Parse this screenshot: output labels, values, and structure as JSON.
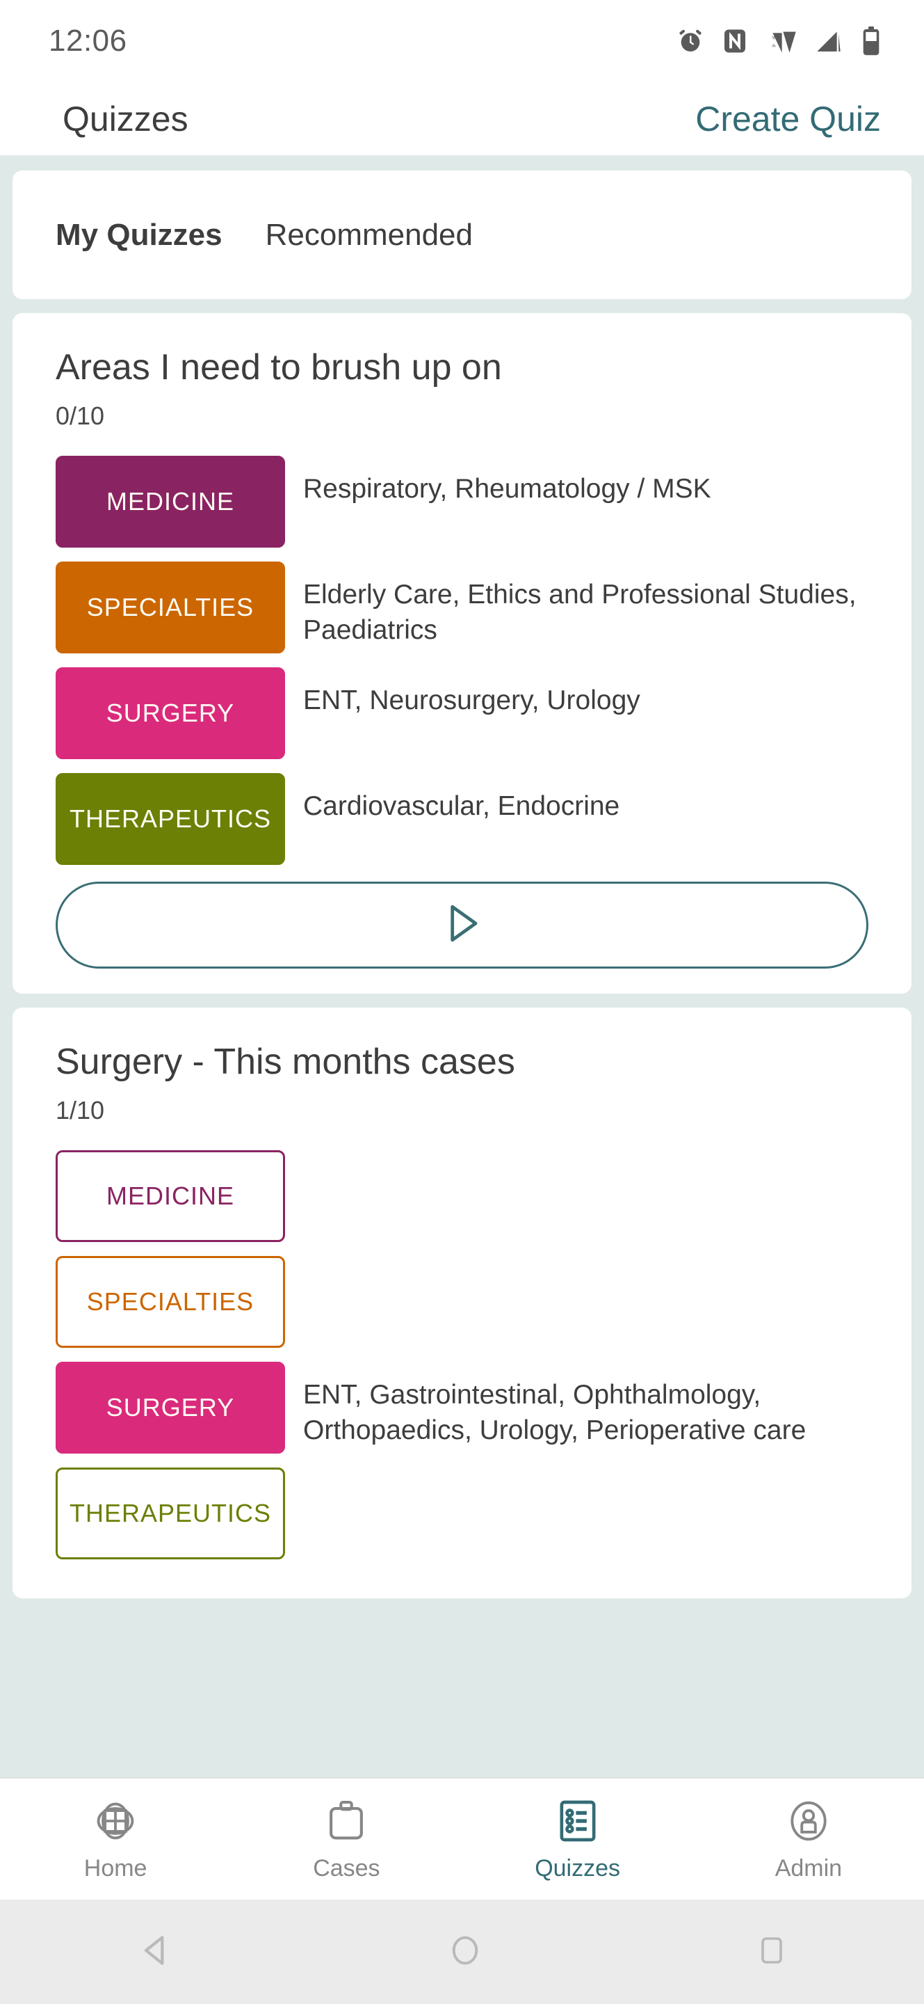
{
  "status_bar": {
    "time": "12:06",
    "icons": [
      "alarm-icon",
      "nfc-icon",
      "wifi-icon",
      "cellular-signal-icon",
      "battery-icon"
    ]
  },
  "header": {
    "title": "Quizzes",
    "action_label": "Create Quiz",
    "accent_color": "#336b75"
  },
  "tabs": [
    {
      "label": "My Quizzes",
      "active": true
    },
    {
      "label": "Recommended",
      "active": false
    }
  ],
  "category_colors": {
    "MEDICINE": "#8a2362",
    "SPECIALTIES": "#cc6600",
    "SURGERY": "#da2a7c",
    "THERAPEUTICS": "#6b8005"
  },
  "quizzes": [
    {
      "title": "Areas I need to brush up on",
      "score": "0/10",
      "categories": [
        {
          "label": "MEDICINE",
          "selected": true,
          "description": "Respiratory, Rheumatology / MSK"
        },
        {
          "label": "SPECIALTIES",
          "selected": true,
          "description": "Elderly Care, Ethics and Professional Studies, Paediatrics"
        },
        {
          "label": "SURGERY",
          "selected": true,
          "description": "ENT, Neurosurgery, Urology"
        },
        {
          "label": "THERAPEUTICS",
          "selected": true,
          "description": "Cardiovascular, Endocrine"
        }
      ],
      "play_button": {
        "icon": "play-icon",
        "label": ""
      }
    },
    {
      "title": "Surgery - This months cases",
      "score": "1/10",
      "categories": [
        {
          "label": "MEDICINE",
          "selected": false,
          "description": ""
        },
        {
          "label": "SPECIALTIES",
          "selected": false,
          "description": ""
        },
        {
          "label": "SURGERY",
          "selected": true,
          "description": "ENT, Gastrointestinal, Ophthalmology, Orthopaedics, Urology, Perioperative care"
        },
        {
          "label": "THERAPEUTICS",
          "selected": false,
          "description": ""
        }
      ]
    }
  ],
  "bottom_nav": [
    {
      "label": "Home",
      "icon": "home-grid-icon",
      "active": false
    },
    {
      "label": "Cases",
      "icon": "briefcase-icon",
      "active": false
    },
    {
      "label": "Quizzes",
      "icon": "checklist-icon",
      "active": true
    },
    {
      "label": "Admin",
      "icon": "person-circle-icon",
      "active": false
    }
  ],
  "android_nav": [
    {
      "name": "back-button",
      "icon": "triangle-back-icon"
    },
    {
      "name": "home-button",
      "icon": "circle-home-icon"
    },
    {
      "name": "recents-button",
      "icon": "square-recents-icon"
    }
  ]
}
